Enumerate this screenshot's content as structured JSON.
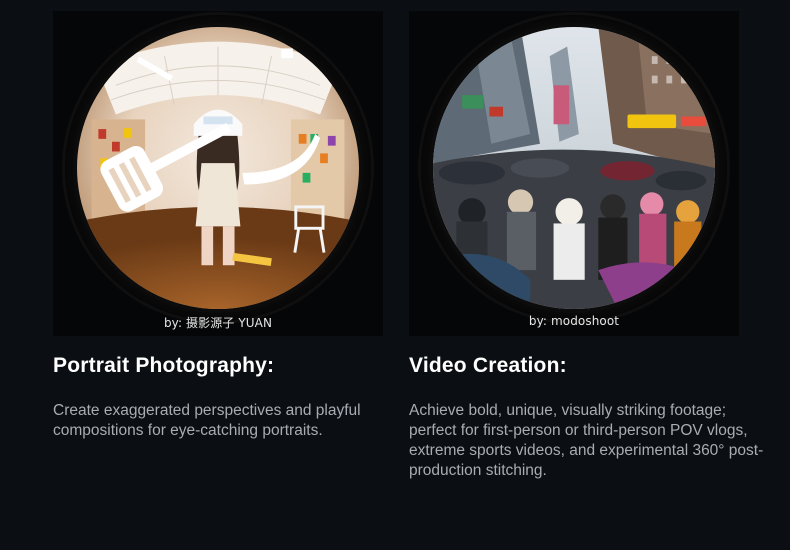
{
  "cards": [
    {
      "credit": "by: 摄影源子 YUAN",
      "title": "Portrait Photography:",
      "description": "Create exaggerated perspectives and playful compositions for eye-catching portraits."
    },
    {
      "credit": "by: modoshoot",
      "title": "Video Creation:",
      "description": "Achieve bold, unique, visually striking footage; perfect for first-person or third-person POV vlogs, extreme sports videos, and experimental 360° post-production stitching."
    }
  ],
  "colors": {
    "background": "#0b0e12",
    "title": "#ffffff",
    "description": "#a8adb4",
    "credit": "#e6e6e6"
  }
}
